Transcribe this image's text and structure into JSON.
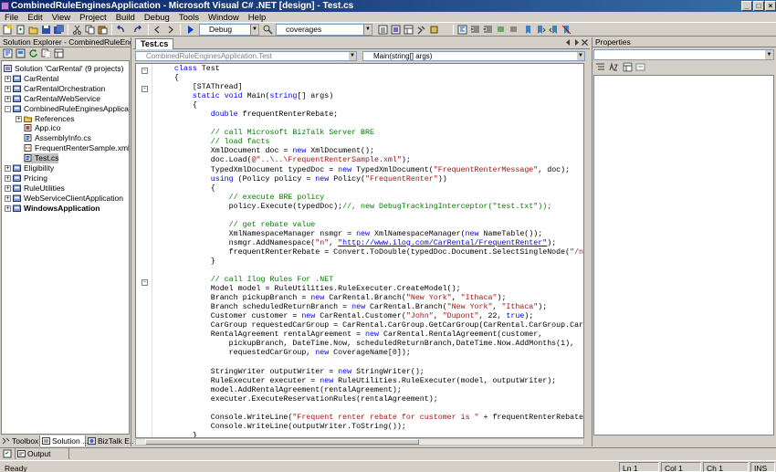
{
  "window": {
    "title": "CombinedRuleEnginesApplication - Microsoft Visual C# .NET [design] - Test.cs"
  },
  "menu": [
    "File",
    "Edit",
    "View",
    "Project",
    "Build",
    "Debug",
    "Tools",
    "Window",
    "Help"
  ],
  "toolbar": {
    "config": "Debug",
    "find_text": "coverages"
  },
  "solution_explorer": {
    "title": "Solution Explorer - CombinedRuleEnginesApplication",
    "items": [
      {
        "label": "Solution 'CarRental' (9 projects)",
        "level": 0,
        "bold": false,
        "expander": ""
      },
      {
        "label": "CarRental",
        "level": 1,
        "bold": false,
        "expander": "+"
      },
      {
        "label": "CarRentalOrchestration",
        "level": 1,
        "bold": false,
        "expander": "+"
      },
      {
        "label": "CarRentalWebService",
        "level": 1,
        "bold": false,
        "expander": "+"
      },
      {
        "label": "CombinedRuleEnginesApplication",
        "level": 1,
        "bold": false,
        "expander": "-"
      },
      {
        "label": "References",
        "level": 2,
        "bold": false,
        "expander": "+"
      },
      {
        "label": "App.ico",
        "level": 2,
        "bold": false,
        "expander": ""
      },
      {
        "label": "AssemblyInfo.cs",
        "level": 2,
        "bold": false,
        "expander": ""
      },
      {
        "label": "FrequentRenterSample.xml",
        "level": 2,
        "bold": false,
        "expander": ""
      },
      {
        "label": "Test.cs",
        "level": 2,
        "bold": false,
        "expander": "",
        "selected": true
      },
      {
        "label": "Eligibility",
        "level": 1,
        "bold": false,
        "expander": "+"
      },
      {
        "label": "Pricing",
        "level": 1,
        "bold": false,
        "expander": "+"
      },
      {
        "label": "RuleUtilities",
        "level": 1,
        "bold": false,
        "expander": "+"
      },
      {
        "label": "WebServiceClientApplication",
        "level": 1,
        "bold": false,
        "expander": "+"
      },
      {
        "label": "WindowsApplication",
        "level": 1,
        "bold": true,
        "expander": "+"
      }
    ]
  },
  "bottom_tabs": [
    "Toolbox",
    "Solution ...",
    "BizTalk E..."
  ],
  "editor": {
    "tab": "Test.cs",
    "class_nav": "CombinedRuleEnginesApplication.Test",
    "member_nav": "Main(string[] args)"
  },
  "properties": {
    "title": "Properties"
  },
  "output": {
    "tab": "Output"
  },
  "status": {
    "text": "Ready",
    "ln": "Ln 1",
    "col": "Col 1",
    "ch": "Ch 1",
    "mode": "INS"
  },
  "colors": {
    "keyword": "#0000ff",
    "comment": "#008000",
    "string": "#a31515",
    "titlebar": "#0a246a"
  }
}
